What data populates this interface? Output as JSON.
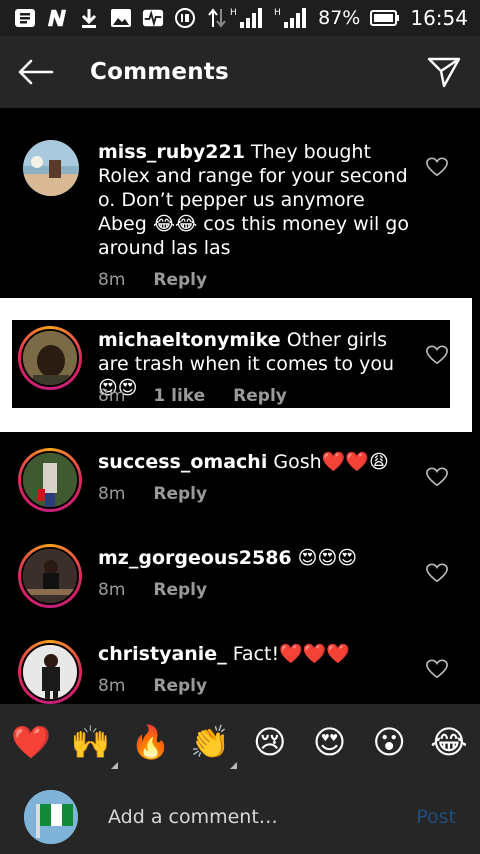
{
  "status_bar": {
    "battery_percent": "87%",
    "time": "16:54",
    "network_type_1": "H",
    "network_type_2": "H",
    "icons": [
      "b-logo-icon",
      "n-logo-icon",
      "download-icon",
      "image-icon",
      "pulse-icon",
      "dial-icon",
      "data-arrows-icon",
      "signal-icon",
      "signal-icon",
      "battery-icon"
    ]
  },
  "header": {
    "title": "Comments",
    "back_icon": "back-arrow-icon",
    "send_icon": "send-icon"
  },
  "comments": [
    {
      "username": "miss_ruby221",
      "text": " They bought Rolex and range for your second o. Don’t pepper us anymore Abeg 😂😂 cos this money wil go around las las",
      "time": "8m",
      "likes": "",
      "reply": "Reply",
      "avatar_ring": false
    },
    {
      "username": "michaeltonymike",
      "text": " Other girls are trash when it comes to you 😍😍",
      "time": "8m",
      "likes": "1 like",
      "reply": "Reply",
      "avatar_ring": true,
      "highlighted": true
    },
    {
      "username": "success_omachi",
      "text": " Gosh❤️❤️😩",
      "time": "8m",
      "likes": "",
      "reply": "Reply",
      "avatar_ring": true
    },
    {
      "username": "mz_gorgeous2586",
      "text": " 😍😍😍",
      "time": "8m",
      "likes": "",
      "reply": "Reply",
      "avatar_ring": true
    },
    {
      "username": "christyanie_",
      "text": " Fact!❤️❤️❤️",
      "time": "8m",
      "likes": "",
      "reply": "Reply",
      "avatar_ring": true
    }
  ],
  "quick_reactions": [
    "❤️",
    "🙌",
    "🔥",
    "👏",
    "😢",
    "😍",
    "😮",
    "😂"
  ],
  "composer": {
    "placeholder": "Add a comment…",
    "post_label": "Post"
  },
  "colors": {
    "background": "#000000",
    "bar": "#262626",
    "meta_text": "#9a9a9a",
    "post_disabled": "#1f4e7a"
  }
}
